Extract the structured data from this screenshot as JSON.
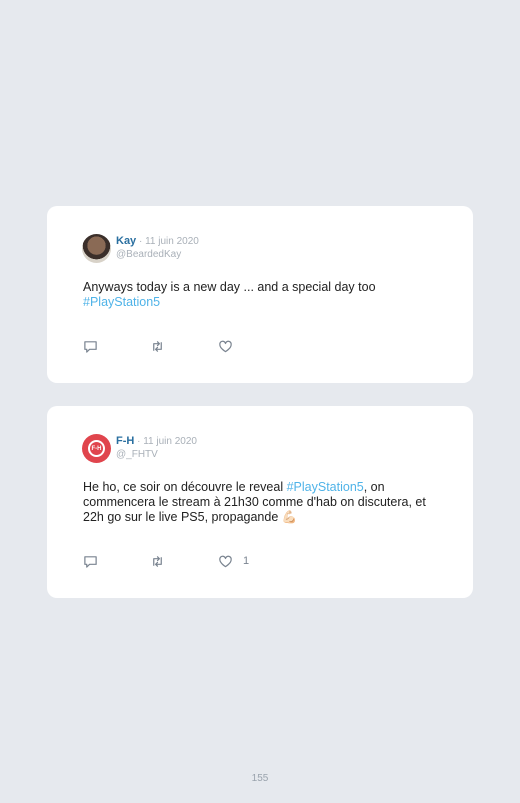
{
  "tweets": [
    {
      "name": "Kay",
      "sep": " · ",
      "date": "11 juin 2020",
      "handle": "@BeardedKay",
      "text_before": "Anyways today is a new day ... and a special day too",
      "hashtag": "#PlayStation5",
      "text_after": "",
      "likes": ""
    },
    {
      "name": "F-H",
      "sep": " · ",
      "date": "11 juin 2020",
      "handle": "@_FHTV",
      "text_before": "He ho, ce soir on découvre le reveal ",
      "hashtag": "#PlayStation5",
      "text_after": ", on commencera le stream à 21h30 comme d'hab on discutera, et 22h go sur le live PS5, propagande 💪🏻",
      "likes": "1"
    }
  ],
  "avatar2_logo": "F-H",
  "page_number": "155",
  "colors": {
    "background": "#e6e9ee",
    "name": "#2a6fa0",
    "hashtag": "#4fb3e8",
    "muted": "#a9b0b8"
  }
}
